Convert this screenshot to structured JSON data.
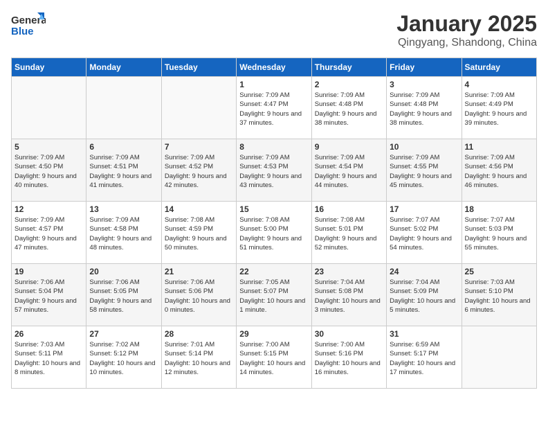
{
  "logo": {
    "line1": "General",
    "line2": "Blue"
  },
  "title": "January 2025",
  "subtitle": "Qingyang, Shandong, China",
  "days_of_week": [
    "Sunday",
    "Monday",
    "Tuesday",
    "Wednesday",
    "Thursday",
    "Friday",
    "Saturday"
  ],
  "weeks": [
    [
      {
        "day": "",
        "info": ""
      },
      {
        "day": "",
        "info": ""
      },
      {
        "day": "",
        "info": ""
      },
      {
        "day": "1",
        "info": "Sunrise: 7:09 AM\nSunset: 4:47 PM\nDaylight: 9 hours and 37 minutes."
      },
      {
        "day": "2",
        "info": "Sunrise: 7:09 AM\nSunset: 4:48 PM\nDaylight: 9 hours and 38 minutes."
      },
      {
        "day": "3",
        "info": "Sunrise: 7:09 AM\nSunset: 4:48 PM\nDaylight: 9 hours and 38 minutes."
      },
      {
        "day": "4",
        "info": "Sunrise: 7:09 AM\nSunset: 4:49 PM\nDaylight: 9 hours and 39 minutes."
      }
    ],
    [
      {
        "day": "5",
        "info": "Sunrise: 7:09 AM\nSunset: 4:50 PM\nDaylight: 9 hours and 40 minutes."
      },
      {
        "day": "6",
        "info": "Sunrise: 7:09 AM\nSunset: 4:51 PM\nDaylight: 9 hours and 41 minutes."
      },
      {
        "day": "7",
        "info": "Sunrise: 7:09 AM\nSunset: 4:52 PM\nDaylight: 9 hours and 42 minutes."
      },
      {
        "day": "8",
        "info": "Sunrise: 7:09 AM\nSunset: 4:53 PM\nDaylight: 9 hours and 43 minutes."
      },
      {
        "day": "9",
        "info": "Sunrise: 7:09 AM\nSunset: 4:54 PM\nDaylight: 9 hours and 44 minutes."
      },
      {
        "day": "10",
        "info": "Sunrise: 7:09 AM\nSunset: 4:55 PM\nDaylight: 9 hours and 45 minutes."
      },
      {
        "day": "11",
        "info": "Sunrise: 7:09 AM\nSunset: 4:56 PM\nDaylight: 9 hours and 46 minutes."
      }
    ],
    [
      {
        "day": "12",
        "info": "Sunrise: 7:09 AM\nSunset: 4:57 PM\nDaylight: 9 hours and 47 minutes."
      },
      {
        "day": "13",
        "info": "Sunrise: 7:09 AM\nSunset: 4:58 PM\nDaylight: 9 hours and 48 minutes."
      },
      {
        "day": "14",
        "info": "Sunrise: 7:08 AM\nSunset: 4:59 PM\nDaylight: 9 hours and 50 minutes."
      },
      {
        "day": "15",
        "info": "Sunrise: 7:08 AM\nSunset: 5:00 PM\nDaylight: 9 hours and 51 minutes."
      },
      {
        "day": "16",
        "info": "Sunrise: 7:08 AM\nSunset: 5:01 PM\nDaylight: 9 hours and 52 minutes."
      },
      {
        "day": "17",
        "info": "Sunrise: 7:07 AM\nSunset: 5:02 PM\nDaylight: 9 hours and 54 minutes."
      },
      {
        "day": "18",
        "info": "Sunrise: 7:07 AM\nSunset: 5:03 PM\nDaylight: 9 hours and 55 minutes."
      }
    ],
    [
      {
        "day": "19",
        "info": "Sunrise: 7:06 AM\nSunset: 5:04 PM\nDaylight: 9 hours and 57 minutes."
      },
      {
        "day": "20",
        "info": "Sunrise: 7:06 AM\nSunset: 5:05 PM\nDaylight: 9 hours and 58 minutes."
      },
      {
        "day": "21",
        "info": "Sunrise: 7:06 AM\nSunset: 5:06 PM\nDaylight: 10 hours and 0 minutes."
      },
      {
        "day": "22",
        "info": "Sunrise: 7:05 AM\nSunset: 5:07 PM\nDaylight: 10 hours and 1 minute."
      },
      {
        "day": "23",
        "info": "Sunrise: 7:04 AM\nSunset: 5:08 PM\nDaylight: 10 hours and 3 minutes."
      },
      {
        "day": "24",
        "info": "Sunrise: 7:04 AM\nSunset: 5:09 PM\nDaylight: 10 hours and 5 minutes."
      },
      {
        "day": "25",
        "info": "Sunrise: 7:03 AM\nSunset: 5:10 PM\nDaylight: 10 hours and 6 minutes."
      }
    ],
    [
      {
        "day": "26",
        "info": "Sunrise: 7:03 AM\nSunset: 5:11 PM\nDaylight: 10 hours and 8 minutes."
      },
      {
        "day": "27",
        "info": "Sunrise: 7:02 AM\nSunset: 5:12 PM\nDaylight: 10 hours and 10 minutes."
      },
      {
        "day": "28",
        "info": "Sunrise: 7:01 AM\nSunset: 5:14 PM\nDaylight: 10 hours and 12 minutes."
      },
      {
        "day": "29",
        "info": "Sunrise: 7:00 AM\nSunset: 5:15 PM\nDaylight: 10 hours and 14 minutes."
      },
      {
        "day": "30",
        "info": "Sunrise: 7:00 AM\nSunset: 5:16 PM\nDaylight: 10 hours and 16 minutes."
      },
      {
        "day": "31",
        "info": "Sunrise: 6:59 AM\nSunset: 5:17 PM\nDaylight: 10 hours and 17 minutes."
      },
      {
        "day": "",
        "info": ""
      }
    ]
  ]
}
